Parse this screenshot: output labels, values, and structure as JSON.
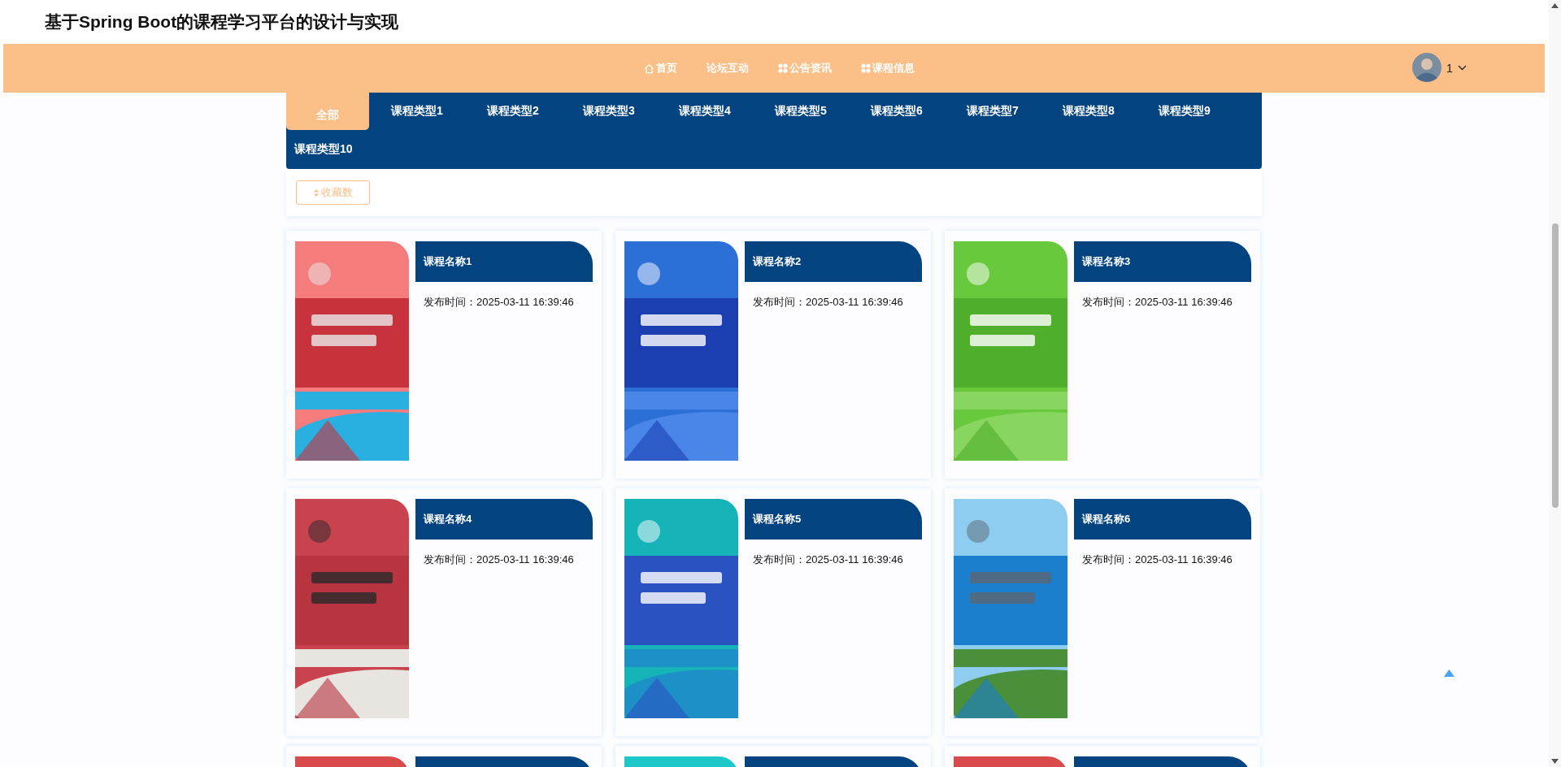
{
  "site_title": "基于Spring Boot的课程学习平台的设计与实现",
  "nav": [
    {
      "label": "首页",
      "kind": "home"
    },
    {
      "label": "论坛互动",
      "kind": "plain"
    },
    {
      "label": "公告资讯",
      "kind": "section"
    },
    {
      "label": "课程信息",
      "kind": "section"
    }
  ],
  "user": {
    "name": "1"
  },
  "categories": [
    {
      "label": "全部",
      "selected": true
    },
    {
      "label": "课程类型1",
      "selected": false
    },
    {
      "label": "课程类型2",
      "selected": false
    },
    {
      "label": "课程类型3",
      "selected": false
    },
    {
      "label": "课程类型4",
      "selected": false
    },
    {
      "label": "课程类型5",
      "selected": false
    },
    {
      "label": "课程类型6",
      "selected": false
    },
    {
      "label": "课程类型7",
      "selected": false
    },
    {
      "label": "课程类型8",
      "selected": false
    },
    {
      "label": "课程类型9",
      "selected": false
    },
    {
      "label": "课程类型10",
      "selected": false
    }
  ],
  "sort_button": {
    "label": "收藏数"
  },
  "courses": [
    {
      "kind": "card",
      "name": "课程名称1",
      "published": "发布时间：2025-03-11 16:39:46"
    },
    {
      "kind": "card",
      "name": "课程名称2",
      "published": "发布时间：2025-03-11 16:39:46"
    },
    {
      "kind": "card",
      "name": "课程名称3",
      "published": "发布时间：2025-03-11 16:39:46"
    },
    {
      "kind": "card",
      "name": "课程名称4",
      "published": "发布时间：2025-03-11 16:39:46"
    },
    {
      "kind": "card",
      "name": "课程名称5",
      "published": "发布时间：2025-03-11 16:39:46"
    },
    {
      "kind": "card",
      "name": "课程名称6",
      "published": "发布时间：2025-03-11 16:39:46"
    },
    {
      "kind": "stub"
    },
    {
      "kind": "stub"
    },
    {
      "kind": "stub"
    }
  ]
}
